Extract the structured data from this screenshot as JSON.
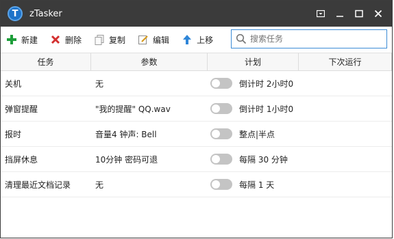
{
  "window": {
    "title": "zTasker",
    "icon_letter": "T"
  },
  "window_controls": [
    "dropdown-icon",
    "minimize-icon",
    "maximize-icon",
    "close-icon"
  ],
  "toolbar": {
    "new_label": "新建",
    "delete_label": "删除",
    "copy_label": "复制",
    "edit_label": "编辑",
    "move_up_label": "上移"
  },
  "search": {
    "placeholder": "搜索任务"
  },
  "columns": {
    "task": "任务",
    "params": "参数",
    "plan": "计划",
    "next_run": "下次运行"
  },
  "rows": [
    {
      "task": "关机",
      "params": "无",
      "plan": "倒计时 2小时0",
      "enabled": false
    },
    {
      "task": "弹窗提醒",
      "params": "\"我的提醒\" QQ.wav",
      "plan": "倒计时 1小时0",
      "enabled": false
    },
    {
      "task": "报时",
      "params": "音量4 钟声: Bell",
      "plan": "整点|半点",
      "enabled": false
    },
    {
      "task": "挡屏休息",
      "params": "10分钟 密码可退",
      "plan": "每隔 30 分钟",
      "enabled": false
    },
    {
      "task": "清理最近文档记录",
      "params": "无",
      "plan": "每隔 1 天",
      "enabled": false
    }
  ],
  "colors": {
    "titlebar": "#3b3b3b",
    "accent": "#3a8bd6",
    "add": "#1d9e3a",
    "delete": "#d32f2f"
  }
}
